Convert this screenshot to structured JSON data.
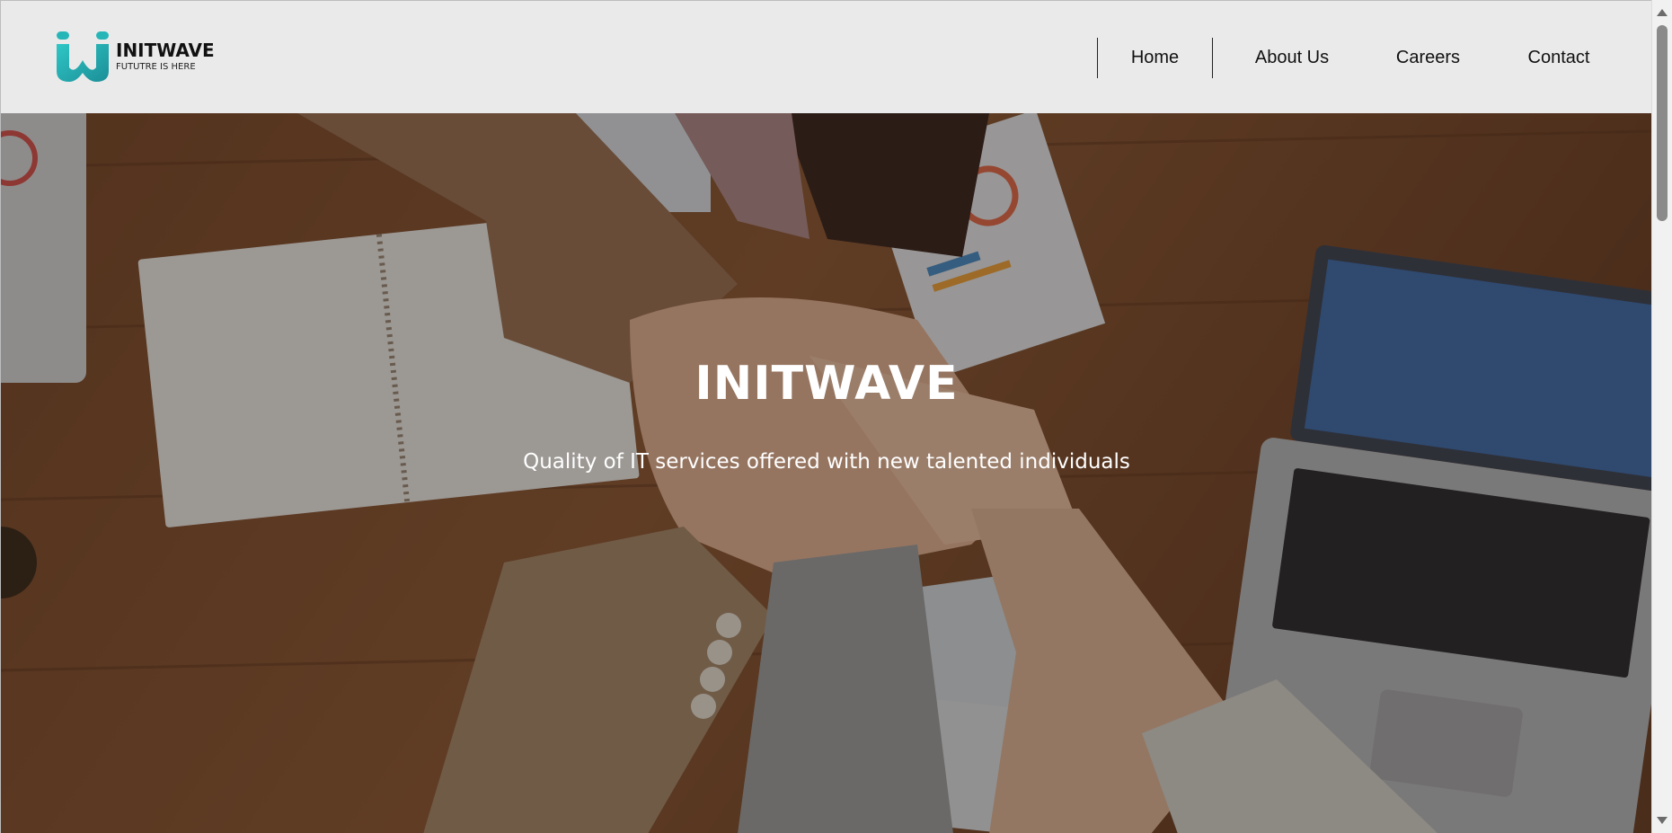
{
  "brand": {
    "name": "INITWAVE",
    "tagline": "FUTUTRE IS HERE",
    "accent": "#1fa3a6"
  },
  "nav": {
    "items": [
      {
        "label": "Home"
      },
      {
        "label": "About Us"
      },
      {
        "label": "Careers"
      },
      {
        "label": "Contact"
      }
    ]
  },
  "hero": {
    "title": "INITWAVE",
    "subtitle": "Quality of IT services offered with new talented individuals",
    "image_icon": "team-hands-photo"
  },
  "colors": {
    "header_bg": "#eaeaea",
    "text_dark": "#111111",
    "hero_text": "#ffffff"
  }
}
